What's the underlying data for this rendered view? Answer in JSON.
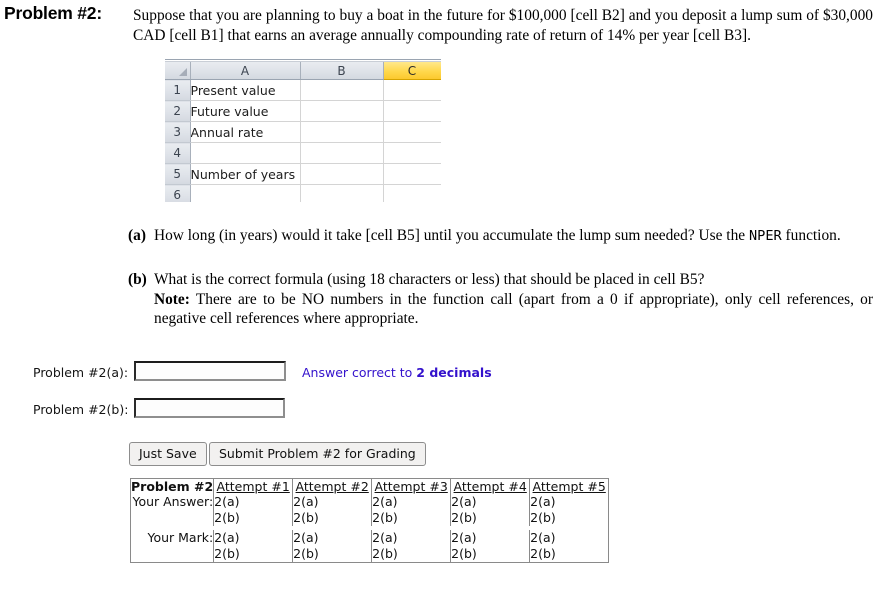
{
  "problem": {
    "label": "Problem #2:",
    "statement": "Suppose that you are planning to buy a boat in the future for $100,000 [cell B2] and you deposit a lump sum of $30,000 CAD [cell B1] that earns an average annually compounding rate of return of 14% per year [cell B3]."
  },
  "spreadsheet": {
    "columns": [
      "A",
      "B",
      "C"
    ],
    "selected_column": "C",
    "rows": [
      {
        "number": "1",
        "a": "Present value",
        "b": "",
        "c": ""
      },
      {
        "number": "2",
        "a": "Future value",
        "b": "",
        "c": ""
      },
      {
        "number": "3",
        "a": "Annual rate",
        "b": "",
        "c": ""
      },
      {
        "number": "4",
        "a": "",
        "b": "",
        "c": ""
      },
      {
        "number": "5",
        "a": "Number of years",
        "b": "",
        "c": ""
      },
      {
        "number": "6",
        "a": "",
        "b": "",
        "c": ""
      }
    ]
  },
  "questions": {
    "a": {
      "marker": "(a)",
      "text_before": "How long (in years) would it take [cell B5] until you accumulate the lump sum needed? Use the ",
      "mono": "NPER",
      "text_after": " function."
    },
    "b": {
      "marker": "(b)",
      "text": "What is the correct formula (using 18 characters or less) that should be placed in cell B5?",
      "note_label": "Note:",
      "note_text": " There are to be NO numbers in the function call (apart from a 0 if appropriate), only cell references, or negative cell references where appropriate."
    }
  },
  "answers": {
    "a": {
      "label": "Problem #2(a):",
      "value": "",
      "hint_prefix": "Answer correct to ",
      "hint_bold": "2 decimals"
    },
    "b": {
      "label": "Problem #2(b):",
      "value": ""
    },
    "hint_color": "#3311cc"
  },
  "buttons": {
    "save": "Just Save",
    "submit": "Submit Problem #2 for Grading"
  },
  "results_table": {
    "corner": "Problem #2",
    "attempts": [
      "Attempt #1",
      "Attempt #2",
      "Attempt #3",
      "Attempt #4",
      "Attempt #5"
    ],
    "rows": [
      {
        "label": "Your Answer:",
        "cells": [
          {
            "line1": "2(a)",
            "line2": "2(b)"
          },
          {
            "line1": "2(a)",
            "line2": "2(b)"
          },
          {
            "line1": "2(a)",
            "line2": "2(b)"
          },
          {
            "line1": "2(a)",
            "line2": "2(b)"
          },
          {
            "line1": "2(a)",
            "line2": "2(b)"
          }
        ]
      },
      {
        "label": "Your Mark:",
        "cells": [
          {
            "line1": "2(a)",
            "line2": "2(b)"
          },
          {
            "line1": "2(a)",
            "line2": "2(b)"
          },
          {
            "line1": "2(a)",
            "line2": "2(b)"
          },
          {
            "line1": "2(a)",
            "line2": "2(b)"
          },
          {
            "line1": "2(a)",
            "line2": "2(b)"
          }
        ]
      }
    ]
  }
}
